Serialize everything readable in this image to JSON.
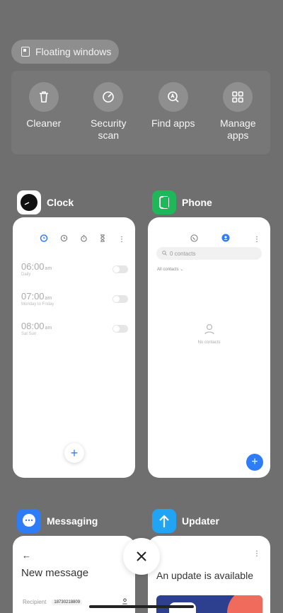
{
  "floating_windows": {
    "label": "Floating windows",
    "icon": "floating-window-icon"
  },
  "tools": [
    {
      "label": "Cleaner",
      "icon": "trash-icon"
    },
    {
      "label": "Security scan",
      "icon": "security-scan-icon"
    },
    {
      "label": "Find apps",
      "icon": "find-apps-icon"
    },
    {
      "label": "Manage apps",
      "icon": "grid-apps-icon"
    }
  ],
  "apps": {
    "clock": {
      "name": "Clock",
      "alarms": [
        {
          "time": "06:00",
          "ampm": "am",
          "repeat": "Daily"
        },
        {
          "time": "07:00",
          "ampm": "am",
          "repeat": "Monday to Friday"
        },
        {
          "time": "08:00",
          "ampm": "am",
          "repeat": "Sat Sun"
        }
      ]
    },
    "phone": {
      "name": "Phone",
      "search_placeholder": "0 contacts",
      "filter": "All contacts",
      "empty": "No contacts"
    },
    "messaging": {
      "name": "Messaging",
      "title": "New message",
      "recipient_label": "Recipient",
      "recipient_value": "18730218809"
    },
    "updater": {
      "name": "Updater",
      "title": "An update is available"
    }
  },
  "colors": {
    "accent": "#2f7df6",
    "phone_green": "#1fb75a",
    "updater_blue": "#21a4f3"
  }
}
